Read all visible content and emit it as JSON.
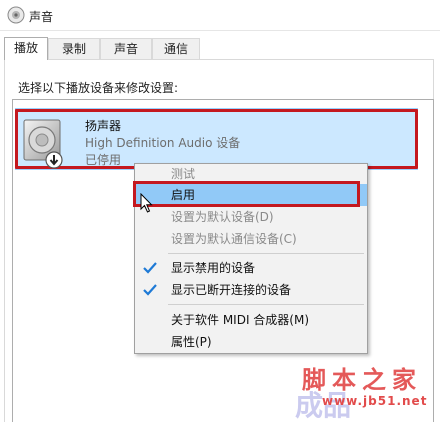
{
  "window": {
    "title": "声音",
    "icon": "speaker-icon"
  },
  "tabs": [
    {
      "label": "播放",
      "active": true
    },
    {
      "label": "录制",
      "active": false
    },
    {
      "label": "声音",
      "active": false
    },
    {
      "label": "通信",
      "active": false
    }
  ],
  "playback": {
    "instruction": "选择以下播放设备来修改设置:",
    "devices": [
      {
        "name": "扬声器",
        "description": "High Definition Audio 设备",
        "status": "已停用",
        "icon": "speaker-device-icon",
        "selected": true
      }
    ]
  },
  "context_menu": {
    "items": [
      {
        "label": "测试",
        "enabled": false,
        "checked": false
      },
      {
        "label": "启用",
        "enabled": true,
        "checked": false,
        "hovered": true
      },
      {
        "label": "设置为默认设备(D)",
        "enabled": false,
        "checked": false
      },
      {
        "label": "设置为默认通信设备(C)",
        "enabled": false,
        "checked": false
      },
      {
        "label": "显示禁用的设备",
        "enabled": true,
        "checked": true
      },
      {
        "label": "显示已断开连接的设备",
        "enabled": true,
        "checked": true
      },
      {
        "label": "关于软件 MIDI 合成器(M)",
        "enabled": true,
        "checked": false
      },
      {
        "label": "属性(P)",
        "enabled": true,
        "checked": false
      }
    ]
  },
  "watermark": {
    "main": "脚本之家",
    "url": "www.jb51.net"
  },
  "colors": {
    "selection": "#cce8ff",
    "menu_hover": "#91c9f7",
    "annotation_red": "#c4181f",
    "check_blue": "#1e7ad6"
  }
}
